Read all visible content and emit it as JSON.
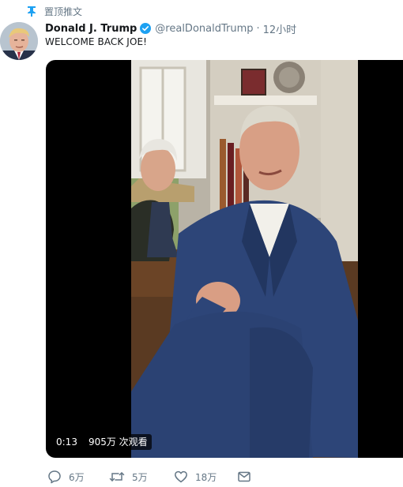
{
  "pinned": {
    "label": "置顶推文",
    "icon": "pin-icon"
  },
  "author": {
    "name": "Donald J. Trump",
    "handle": "@realDonaldTrump",
    "separator": "·",
    "time": "12小时",
    "verified_icon": "verified-badge-icon"
  },
  "tweet": {
    "text": "WELCOME BACK JOE!"
  },
  "media": {
    "duration": "0:13",
    "views": "905万 次观看"
  },
  "actions": {
    "reply": {
      "icon": "reply-icon",
      "count": "6万"
    },
    "retweet": {
      "icon": "retweet-icon",
      "count": "5万"
    },
    "like": {
      "icon": "like-heart-icon",
      "count": "18万"
    },
    "message": {
      "icon": "direct-message-icon"
    }
  },
  "colors": {
    "secondary_text": "#657786",
    "verified_blue": "#1da1f2",
    "pin_blue": "#1da1f2"
  }
}
